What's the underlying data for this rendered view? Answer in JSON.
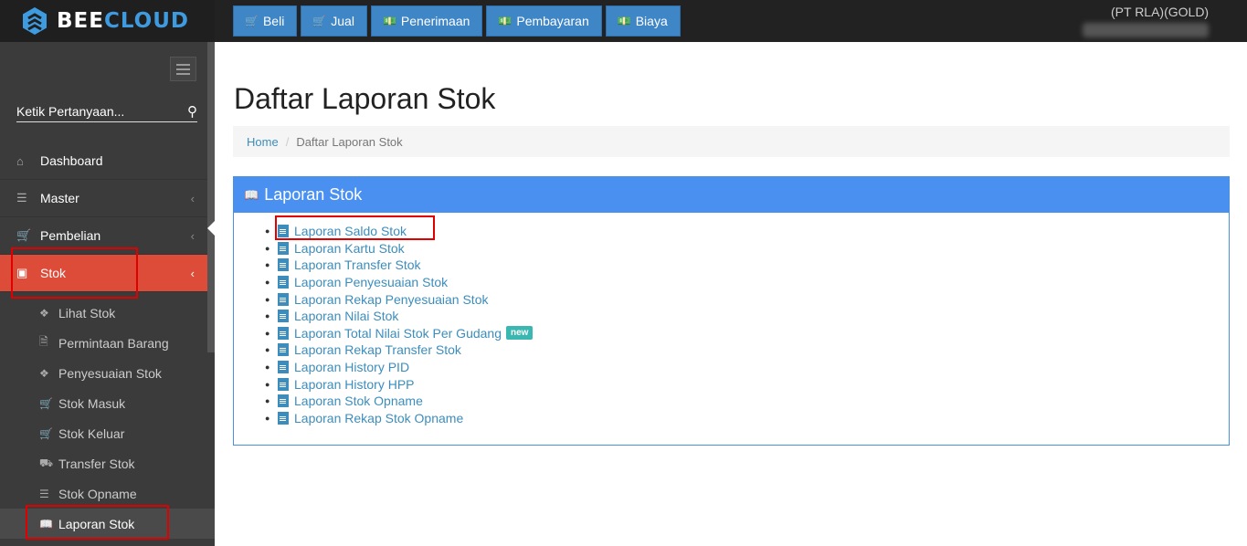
{
  "brand": {
    "name_part1": "BEE",
    "name_part2": "CLOUD"
  },
  "topnav": [
    {
      "label": "Beli",
      "icon": "cart-icon"
    },
    {
      "label": "Jual",
      "icon": "cart-icon"
    },
    {
      "label": "Penerimaan",
      "icon": "money-icon"
    },
    {
      "label": "Pembayaran",
      "icon": "money-icon"
    },
    {
      "label": "Biaya",
      "icon": "money-icon"
    }
  ],
  "company": "(PT RLA)(GOLD)",
  "sidebar": {
    "search_placeholder": "Ketik Pertanyaan...",
    "menu": [
      {
        "label": "Dashboard",
        "icon": "home-icon"
      },
      {
        "label": "Master",
        "icon": "database-icon"
      },
      {
        "label": "Pembelian",
        "icon": "cart-icon"
      },
      {
        "label": "Stok",
        "icon": "archive-icon",
        "active": true
      }
    ],
    "submenu": [
      {
        "label": "Lihat Stok",
        "icon": "cubes-icon"
      },
      {
        "label": "Permintaan Barang",
        "icon": "file-icon"
      },
      {
        "label": "Penyesuaian Stok",
        "icon": "cubes-icon"
      },
      {
        "label": "Stok Masuk",
        "icon": "cart-icon"
      },
      {
        "label": "Stok Keluar",
        "icon": "cart-icon"
      },
      {
        "label": "Transfer Stok",
        "icon": "truck-icon"
      },
      {
        "label": "Stok Opname",
        "icon": "list-icon"
      },
      {
        "label": "Laporan Stok",
        "icon": "book-icon",
        "current": true
      }
    ]
  },
  "page": {
    "title": "Daftar Laporan Stok",
    "breadcrumb": {
      "home": "Home",
      "current": "Daftar Laporan Stok"
    },
    "panel_title": "Laporan Stok",
    "reports": [
      {
        "label": "Laporan Saldo Stok"
      },
      {
        "label": "Laporan Kartu Stok"
      },
      {
        "label": "Laporan Transfer Stok"
      },
      {
        "label": "Laporan Penyesuaian Stok"
      },
      {
        "label": "Laporan Rekap Penyesuaian Stok"
      },
      {
        "label": "Laporan Nilai Stok"
      },
      {
        "label": "Laporan Total Nilai Stok Per Gudang",
        "badge": "new"
      },
      {
        "label": "Laporan Rekap Transfer Stok"
      },
      {
        "label": "Laporan History PID"
      },
      {
        "label": "Laporan History HPP"
      },
      {
        "label": "Laporan Stok Opname"
      },
      {
        "label": "Laporan Rekap Stok Opname"
      }
    ]
  }
}
